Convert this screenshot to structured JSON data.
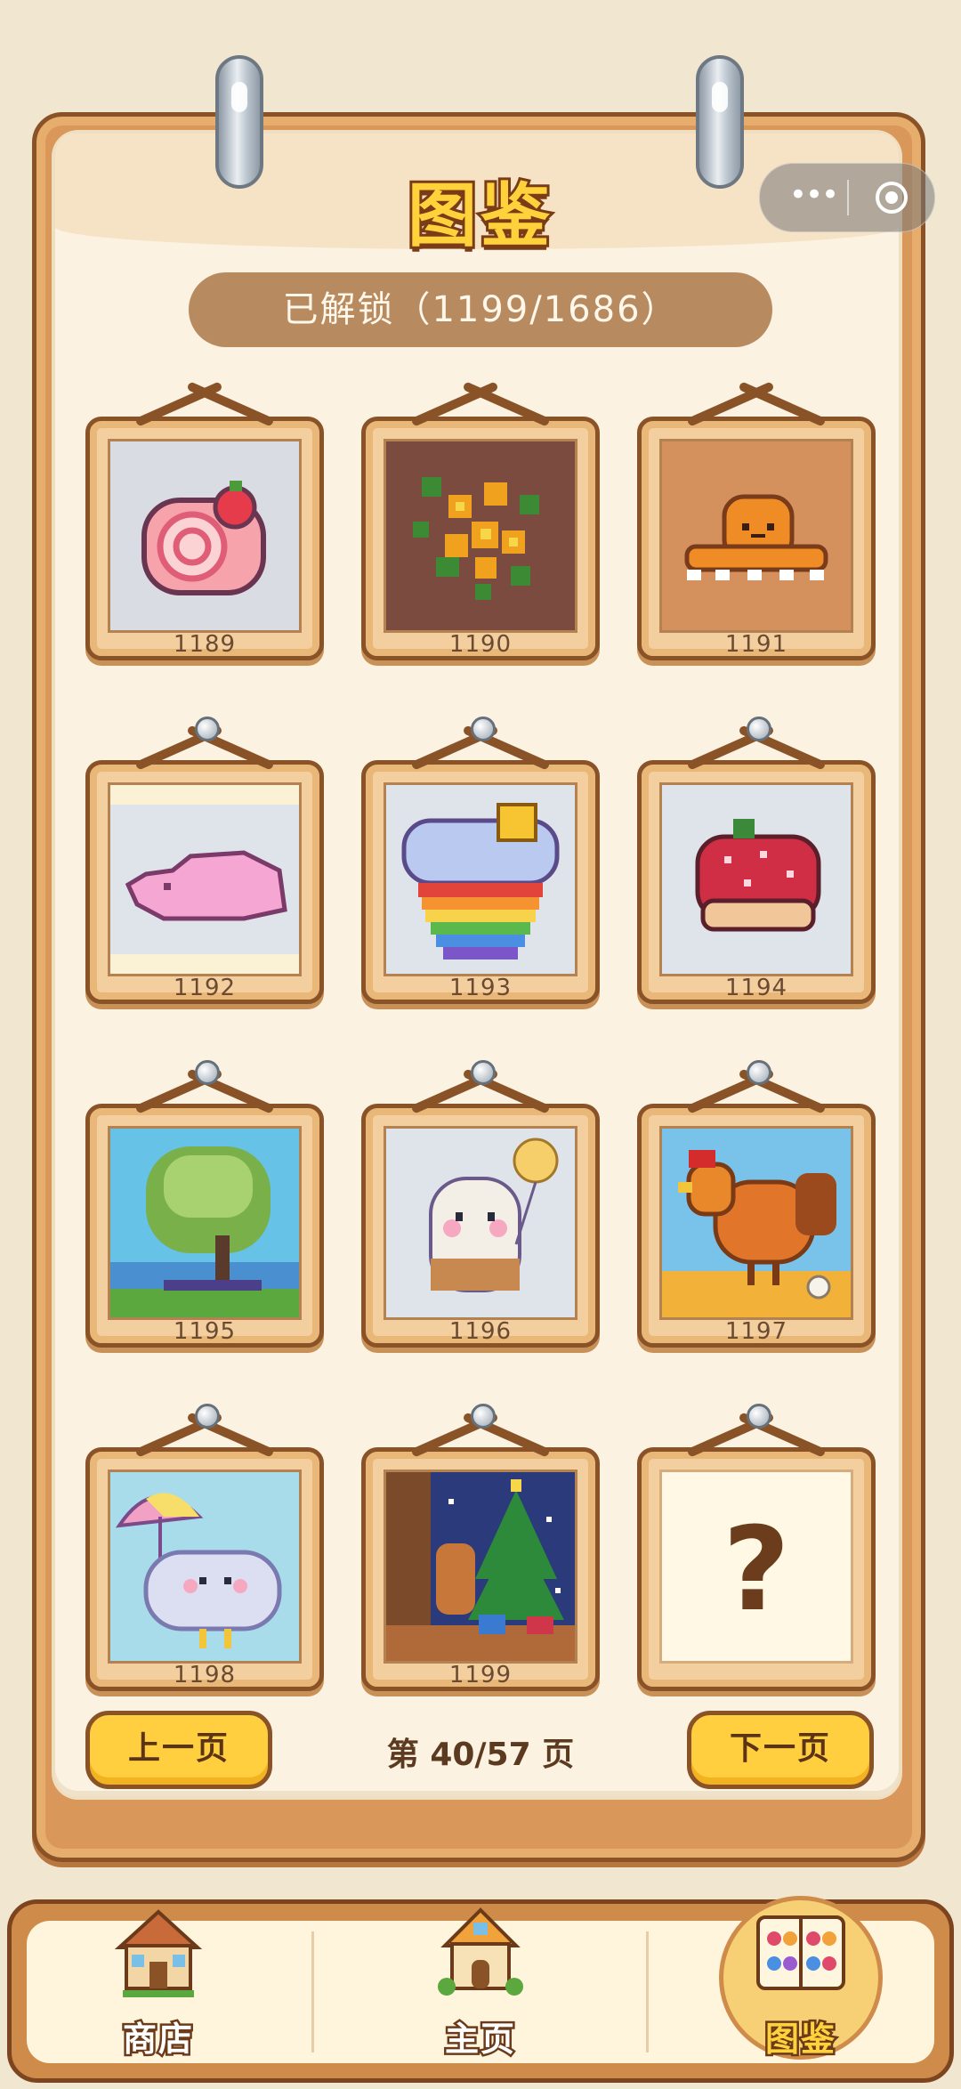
{
  "page": {
    "title": "图鉴",
    "unlocked_text": "已解锁（1199/1686）"
  },
  "capsule": {
    "more_label": "•••"
  },
  "gallery": {
    "items": [
      {
        "number": "1189",
        "subject": "swiss roll cake with strawberry"
      },
      {
        "number": "1190",
        "subject": "flowers on brown background"
      },
      {
        "number": "1191",
        "subject": "orange octopus"
      },
      {
        "number": "1192",
        "subject": "pink sleeping creature"
      },
      {
        "number": "1193",
        "subject": "rainbow cupcake"
      },
      {
        "number": "1194",
        "subject": "strawberry tart"
      },
      {
        "number": "1195",
        "subject": "tree by lake"
      },
      {
        "number": "1196",
        "subject": "ghost with balloon"
      },
      {
        "number": "1197",
        "subject": "rooster"
      },
      {
        "number": "1198",
        "subject": "cloud with umbrella"
      },
      {
        "number": "1199",
        "subject": "cat and christmas tree"
      },
      {
        "number": "",
        "subject": "locked",
        "locked_glyph": "?"
      }
    ]
  },
  "pager": {
    "prev_label": "上一页",
    "indicator": "第 40/57 页",
    "next_label": "下一页",
    "current_page": 40,
    "total_pages": 57
  },
  "tabs": [
    {
      "label": "商店",
      "icon": "shop-house-icon",
      "active": false
    },
    {
      "label": "主页",
      "icon": "home-cottage-icon",
      "active": false
    },
    {
      "label": "图鉴",
      "icon": "flower-book-icon",
      "active": true
    }
  ],
  "colors": {
    "board": "#d9985a",
    "paper": "#fbf2e2",
    "accent_yellow": "#ffcf3f",
    "outline_brown": "#8a5227",
    "progress_pill": "#b88a60"
  }
}
